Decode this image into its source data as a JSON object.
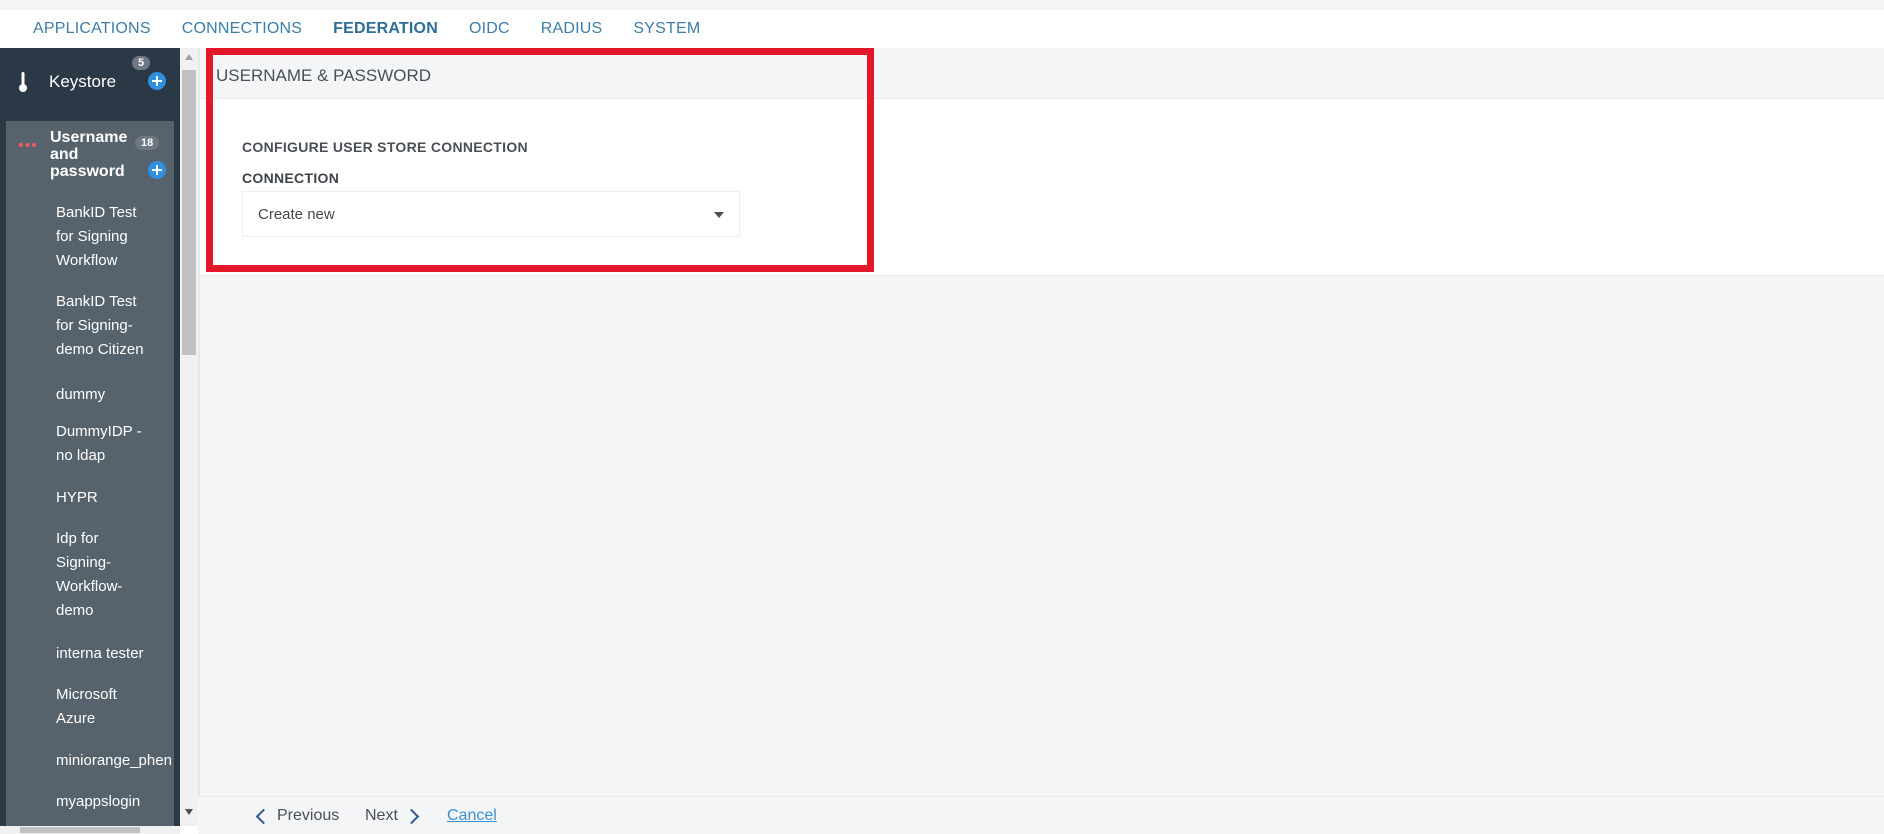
{
  "topnav": {
    "tabs": [
      {
        "label": "APPLICATIONS"
      },
      {
        "label": "CONNECTIONS"
      },
      {
        "label": "FEDERATION"
      },
      {
        "label": "OIDC"
      },
      {
        "label": "RADIUS"
      },
      {
        "label": "SYSTEM"
      }
    ],
    "active_tab": "FEDERATION"
  },
  "sidebar": {
    "keystore": {
      "label": "Keystore",
      "count": "5"
    },
    "group": {
      "label": "Username and password",
      "count": "18"
    },
    "items": [
      {
        "label": "BankID Test for Signing Workflow"
      },
      {
        "label": "BankID Test for Signing-demo Citizen"
      },
      {
        "label": "dummy"
      },
      {
        "label": "DummyIDP - no ldap"
      },
      {
        "label": "HYPR"
      },
      {
        "label": "Idp for Signing-Workflow-demo"
      },
      {
        "label": "interna tester"
      },
      {
        "label": "Microsoft Azure"
      },
      {
        "label": "miniorange_phen"
      },
      {
        "label": "myappslogin"
      }
    ]
  },
  "main": {
    "title": "USERNAME & PASSWORD",
    "section_title": "CONFIGURE USER STORE CONNECTION",
    "connection_label": "CONNECTION",
    "connection_value": "Create new"
  },
  "footer": {
    "previous_label": "Previous",
    "next_label": "Next",
    "cancel_label": "Cancel"
  },
  "colors": {
    "accent": "#3d7ea6",
    "sidebar_bg": "#2b3845",
    "highlight": "#e3172a",
    "plus_button": "#2f90e0"
  }
}
